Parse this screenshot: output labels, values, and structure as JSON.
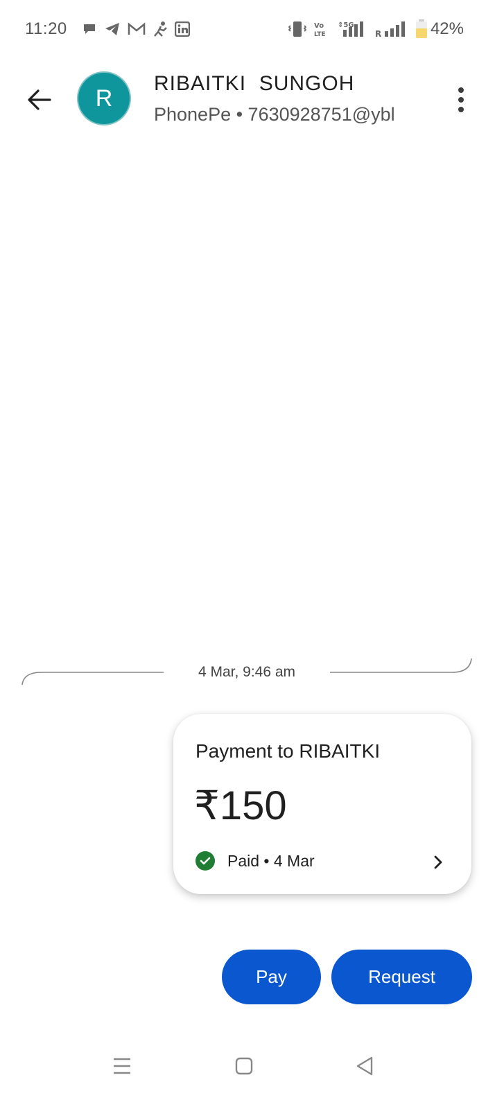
{
  "status_bar": {
    "time": "11:20",
    "battery": "42%",
    "notification_icons": [
      "chat-bubble-icon",
      "telegram-icon",
      "gmail-icon",
      "sports-icon",
      "linkedin-icon"
    ],
    "system_icons": [
      "vibrate-icon",
      "volte-icon",
      "signal-5g-icon",
      "signal-roaming-icon",
      "battery-icon"
    ],
    "labels": {
      "volte": "Vo LTE",
      "network": "5G",
      "roaming": "R"
    }
  },
  "header": {
    "avatar_initial": "R",
    "avatar_color": "#0f969c",
    "contact_name": "RIBAITKI  SUNGOH",
    "contact_sub": "PhonePe • 7630928751@ybl"
  },
  "conversation": {
    "date_divider": "4 Mar, 9:46 am",
    "payment": {
      "title": "Payment to RIBAITKI",
      "amount": "₹150",
      "status": "Paid • 4 Mar",
      "status_color": "#1e7e34"
    }
  },
  "actions": {
    "pay_label": "Pay",
    "request_label": "Request",
    "accent": "#0b57d0"
  },
  "nav": {
    "items": [
      "recents-icon",
      "home-icon",
      "back-nav-icon"
    ]
  }
}
